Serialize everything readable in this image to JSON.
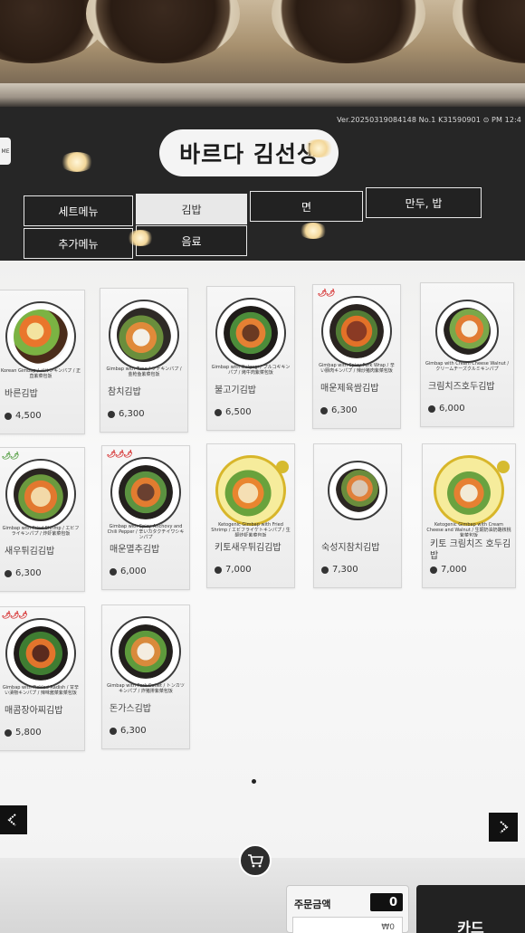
{
  "header": {
    "version": "Ver.20250319084148",
    "terminal": "No.1 K31590901",
    "clock": "⊙ PM 12:4",
    "lang": "ME",
    "brand": "바르다 김선생"
  },
  "categories": [
    {
      "label": "세트메뉴",
      "active": false
    },
    {
      "label": "김밥",
      "active": true
    },
    {
      "label": "면",
      "active": false
    },
    {
      "label": "만두, 밥",
      "active": false
    },
    {
      "label": "추가메뉴",
      "active": false
    },
    {
      "label": "음료",
      "active": false
    }
  ],
  "menu_items": [
    {
      "name": "바른김밥",
      "en": "Korean Gimbap / バルンキンパプ / 正直紫菜包饭",
      "price": "4,500",
      "tag": ""
    },
    {
      "name": "참치김밥",
      "en": "Gimbap with Tuna / ツナキンパプ / 金枪鱼紫菜包饭",
      "price": "6,300",
      "tag": ""
    },
    {
      "name": "불고기김밥",
      "en": "Gimbap with Bulgogi / プルコギキンパプ / 烤牛肉紫菜包饭",
      "price": "6,500",
      "tag": ""
    },
    {
      "name": "매운제육쌈김밥",
      "en": "Gimbap with Spicy Pork Wrap / 辛い豚肉キンパプ / 辣炒猪肉紫菜包饭",
      "price": "6,300",
      "tag": "🌶🌶"
    },
    {
      "name": "크림치즈호두김밥",
      "en": "Gimbap with Cream Cheese Walnut / クリームチーズクルミキンパプ",
      "price": "6,000",
      "tag": ""
    },
    {
      "name": "새우튀김김밥",
      "en": "Gimbap with Fried Shrimp / エビフライキンパプ / 炸虾紫菜包饭",
      "price": "6,300",
      "tag": "🌶🌶"
    },
    {
      "name": "매운멸추김밥",
      "en": "Gimbap with Spicy Anchovy and Chili Pepper / 辛いカタクチイワシキンパプ",
      "price": "6,000",
      "tag": "🌶🌶🌶"
    },
    {
      "name": "키토새우튀김김밥",
      "en": "Ketogenic Gimbap with Fried Shrimp / エビフライケトキンパプ / 生酮炸虾紫菜包饭",
      "price": "7,000",
      "tag": ""
    },
    {
      "name": "숙성지참치김밥",
      "en": "",
      "price": "7,300",
      "tag": ""
    },
    {
      "name": "키토 크림치즈 호두김밥",
      "en": "Ketogenic Gimbap with Cream Cheese and Walnut / 生酮奶油奶酪核桃紫菜包饭",
      "price": "7,000",
      "tag": ""
    },
    {
      "name": "매콤장아찌김밥",
      "en": "Gimbap with Pickled Radish / 甘辛い漬物キンパプ / 辣味酱菜紫菜包饭",
      "price": "5,800",
      "tag": "🌶🌶🌶"
    },
    {
      "name": "돈가스김밥",
      "en": "Gimbap with Pork Cutlet / トンカツキンパプ / 炸猪排紫菜包饭",
      "price": "6,300",
      "tag": ""
    }
  ],
  "footer": {
    "order_total_label": "주문금액",
    "order_count": "0",
    "order_amount": "₩0",
    "pay_button": "카드"
  },
  "colors": {
    "header_bg": "#262626",
    "content_bg": "#f4f4f4",
    "spicy_red": "#d32222",
    "keto_gold": "#d6bb2f"
  },
  "icons": {
    "cart": "cart-icon",
    "prev": "arrow-left-icon",
    "next": "arrow-right-icon"
  }
}
